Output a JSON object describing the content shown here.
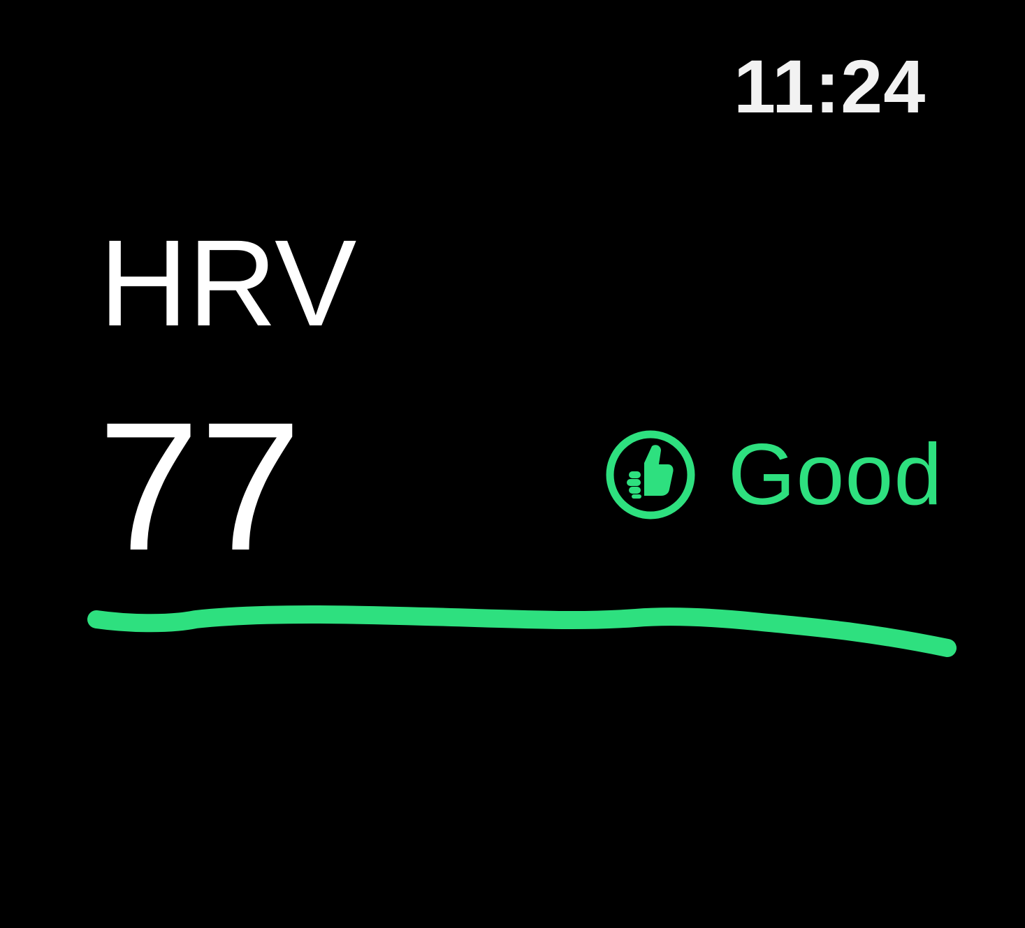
{
  "status_bar": {
    "time": "11:24"
  },
  "metric": {
    "title": "HRV",
    "value": "77",
    "status_label": "Good",
    "status_icon": "thumbs-up-icon"
  },
  "colors": {
    "background": "#000000",
    "text": "#ffffff",
    "accent_good": "#2ee07f"
  }
}
